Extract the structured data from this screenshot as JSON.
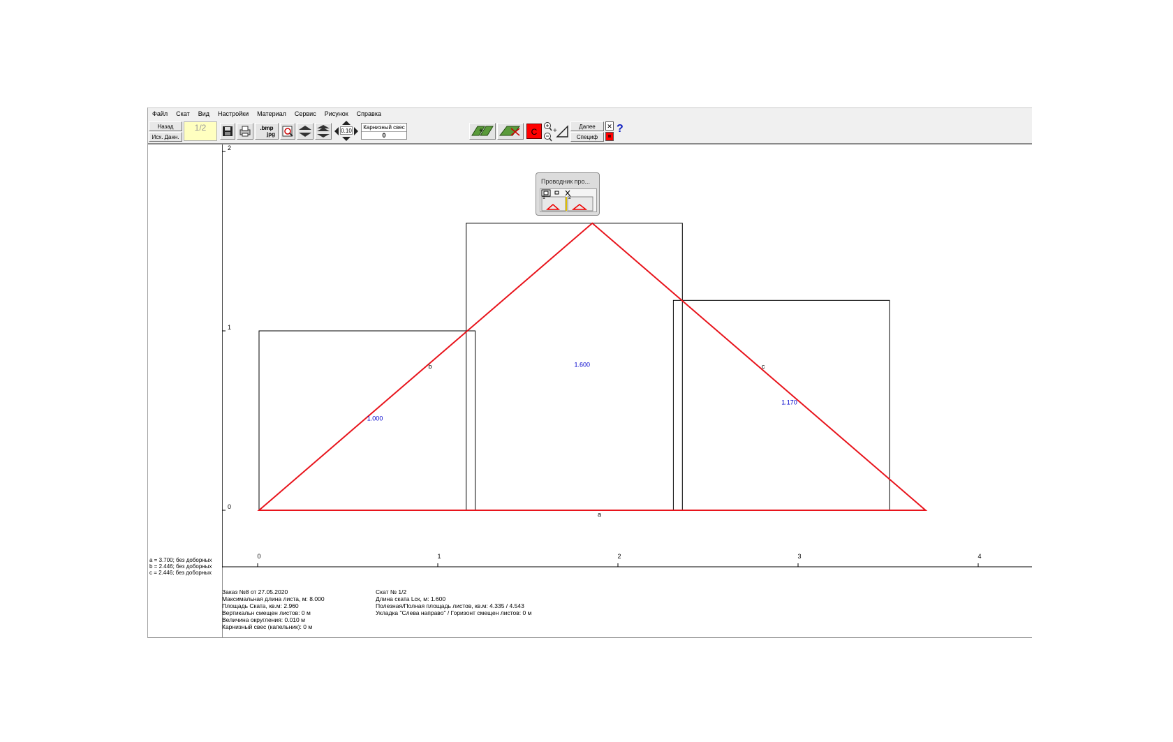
{
  "menu": [
    "Файл",
    "Скат",
    "Вид",
    "Настройки",
    "Материал",
    "Сервис",
    "Рисунок",
    "Справка"
  ],
  "toolbar": {
    "back_label": "Назад",
    "source_label": "Исх. Данн.",
    "slope_field": "1/2",
    "bmp_label": ".bmp",
    "jpg_label": "jpg",
    "step_value": "0.10",
    "eaves_label": "Карнизный свес",
    "eaves_value": "0",
    "c_label": "C",
    "next_label": "Далее",
    "spec_label": "Специф",
    "close_label": "✕",
    "help_label": "?"
  },
  "navigator": {
    "title": "Проводник про...",
    "items": [
      "1",
      "2"
    ]
  },
  "legend": [
    "a = 3.700; без доборных",
    "b = 2.446; без доборных",
    "c = 2.446; без доборных"
  ],
  "axes": {
    "y_ticks": [
      "2",
      "1",
      "0"
    ],
    "x_ticks": [
      "0",
      "1",
      "2",
      "3",
      "4"
    ]
  },
  "chart_data": {
    "type": "diagram",
    "sheets": [
      {
        "x0": 0.0,
        "x1": 1.2,
        "height": 1.0,
        "label": "1.000"
      },
      {
        "x0": 1.15,
        "x1": 2.35,
        "height": 1.6,
        "label": "1.600"
      },
      {
        "x0": 2.3,
        "x1": 3.5,
        "height": 1.17,
        "label": "1.170"
      }
    ],
    "triangle": {
      "apex": [
        1.85,
        1.6
      ],
      "base": [
        0,
        3.7
      ]
    },
    "side_labels": [
      "a",
      "b",
      "c"
    ],
    "xlim": [
      0,
      4
    ],
    "ylim": [
      0,
      2
    ],
    "outline_color": "#e8141c",
    "label_color": "#0000cc"
  },
  "info_left": [
    "Заказ №8 от 27.05.2020",
    "Максимальная длина листа, м: 8.000",
    "Площадь Ската, кв.м:  2.960",
    "Вертикальн смещен листов: 0 м",
    "Величина округления: 0.010 м",
    "Карнизный свес (капельник): 0 м"
  ],
  "info_right": [
    "Скат № 1/2",
    "Длина ската Lск, м: 1.600",
    "Полезная/Полная площадь листов, кв.м:  4.335 / 4.543",
    "Укладка \"Слева направо\" / Горизонт смещен листов: 0 м"
  ]
}
